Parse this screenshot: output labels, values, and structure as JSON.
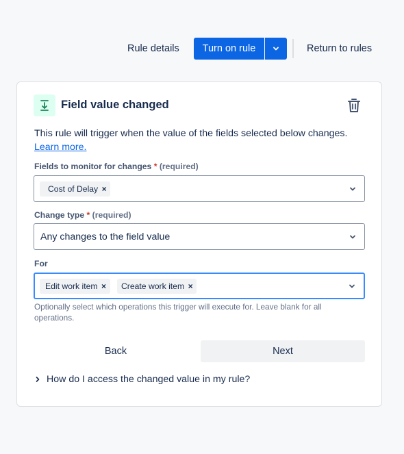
{
  "toolbar": {
    "rule_details_label": "Rule details",
    "turn_on_label": "Turn on rule",
    "return_label": "Return to rules"
  },
  "card": {
    "title": "Field value changed",
    "description": "This rule will trigger when the value of the fields selected below changes.",
    "learn_more": "Learn more.",
    "fields_label": "Fields to monitor for changes",
    "fields_required": "(required)",
    "fields_chips": [
      "Cost of Delay"
    ],
    "change_type_label": "Change type",
    "change_type_required": "(required)",
    "change_type_value": "Any changes to the field value",
    "for_label": "For",
    "for_chips": [
      "Edit work item",
      "Create work item"
    ],
    "help_text": "Optionally select which operations this trigger will execute for. Leave blank for all operations.",
    "back_label": "Back",
    "next_label": "Next",
    "expander_label": "How do I access the changed value in my rule?"
  },
  "colors": {
    "primary": "#0c66e4",
    "icon_bg": "#dcfff1",
    "icon_fg": "#1f845a",
    "required": "#c9372c",
    "focus_border": "#388bff"
  },
  "icons": {
    "trigger": "download-arrow-icon",
    "delete": "trash-icon",
    "dropdown": "chevron-down-icon",
    "remove": "close-icon",
    "expand": "chevron-right-icon"
  }
}
